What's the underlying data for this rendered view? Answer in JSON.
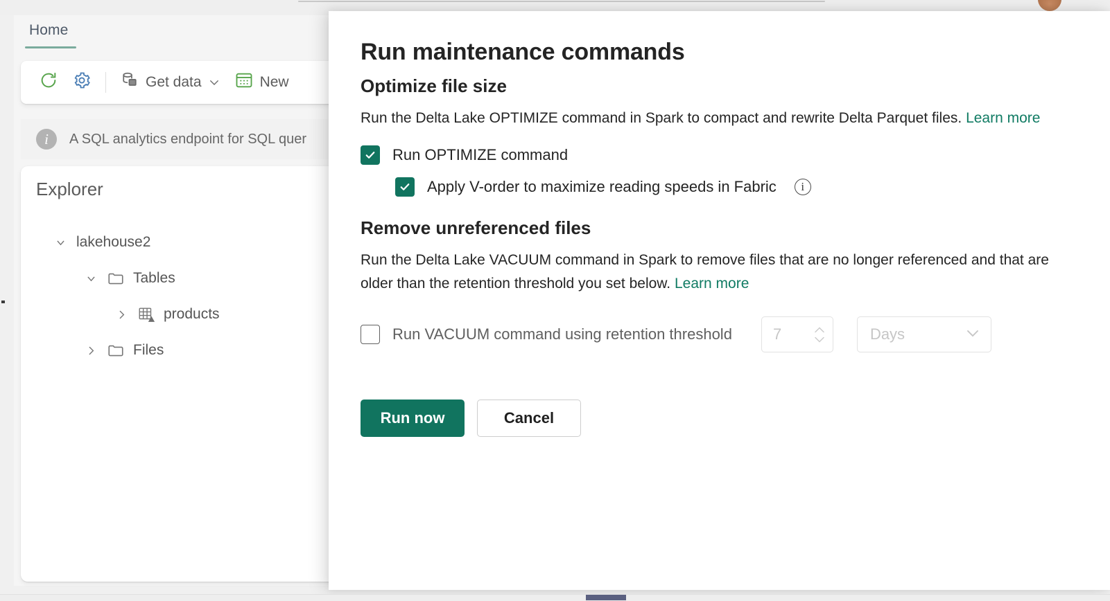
{
  "app": {
    "tab_label": "Home",
    "toolbar": {
      "refresh_label": "",
      "settings_label": "",
      "get_data_label": "Get data",
      "new_label": "New"
    },
    "info_bar": {
      "text": "A SQL analytics endpoint for SQL quer"
    },
    "explorer": {
      "title": "Explorer",
      "collapse_label": "«",
      "tree": [
        {
          "label": "lakehouse2",
          "level": 0,
          "expanded": true,
          "icon": "none"
        },
        {
          "label": "Tables",
          "level": 1,
          "expanded": true,
          "icon": "folder-icon"
        },
        {
          "label": "products",
          "level": 2,
          "expanded": false,
          "icon": "delta-table-icon"
        },
        {
          "label": "Files",
          "level": 1,
          "expanded": false,
          "icon": "folder-icon"
        }
      ]
    }
  },
  "dialog": {
    "title": "Run maintenance commands",
    "optimize": {
      "heading": "Optimize file size",
      "description": "Run the Delta Lake OPTIMIZE command in Spark to compact and rewrite Delta Parquet files.",
      "learn_more": "Learn more",
      "run_optimize_label": "Run OPTIMIZE command",
      "run_optimize_checked": true,
      "vorder_label": "Apply V-order to maximize reading speeds in Fabric",
      "vorder_checked": true
    },
    "vacuum": {
      "heading": "Remove unreferenced files",
      "description": "Run the Delta Lake VACUUM command in Spark to remove files that are no longer referenced and that are older than the retention threshold you set below.",
      "learn_more": "Learn more",
      "run_vacuum_label": "Run VACUUM command using retention threshold",
      "run_vacuum_checked": false,
      "retention_value": "7",
      "retention_unit": "Days"
    },
    "actions": {
      "primary_label": "Run now",
      "secondary_label": "Cancel"
    }
  },
  "colors": {
    "accent_green": "#11745f",
    "link_green": "#107b63",
    "tab_underline": "#7aab9d",
    "refresh_icon": "#57a44b",
    "gear_icon": "#4b7eb5",
    "scrollbar_thumb": "#5b6080"
  }
}
